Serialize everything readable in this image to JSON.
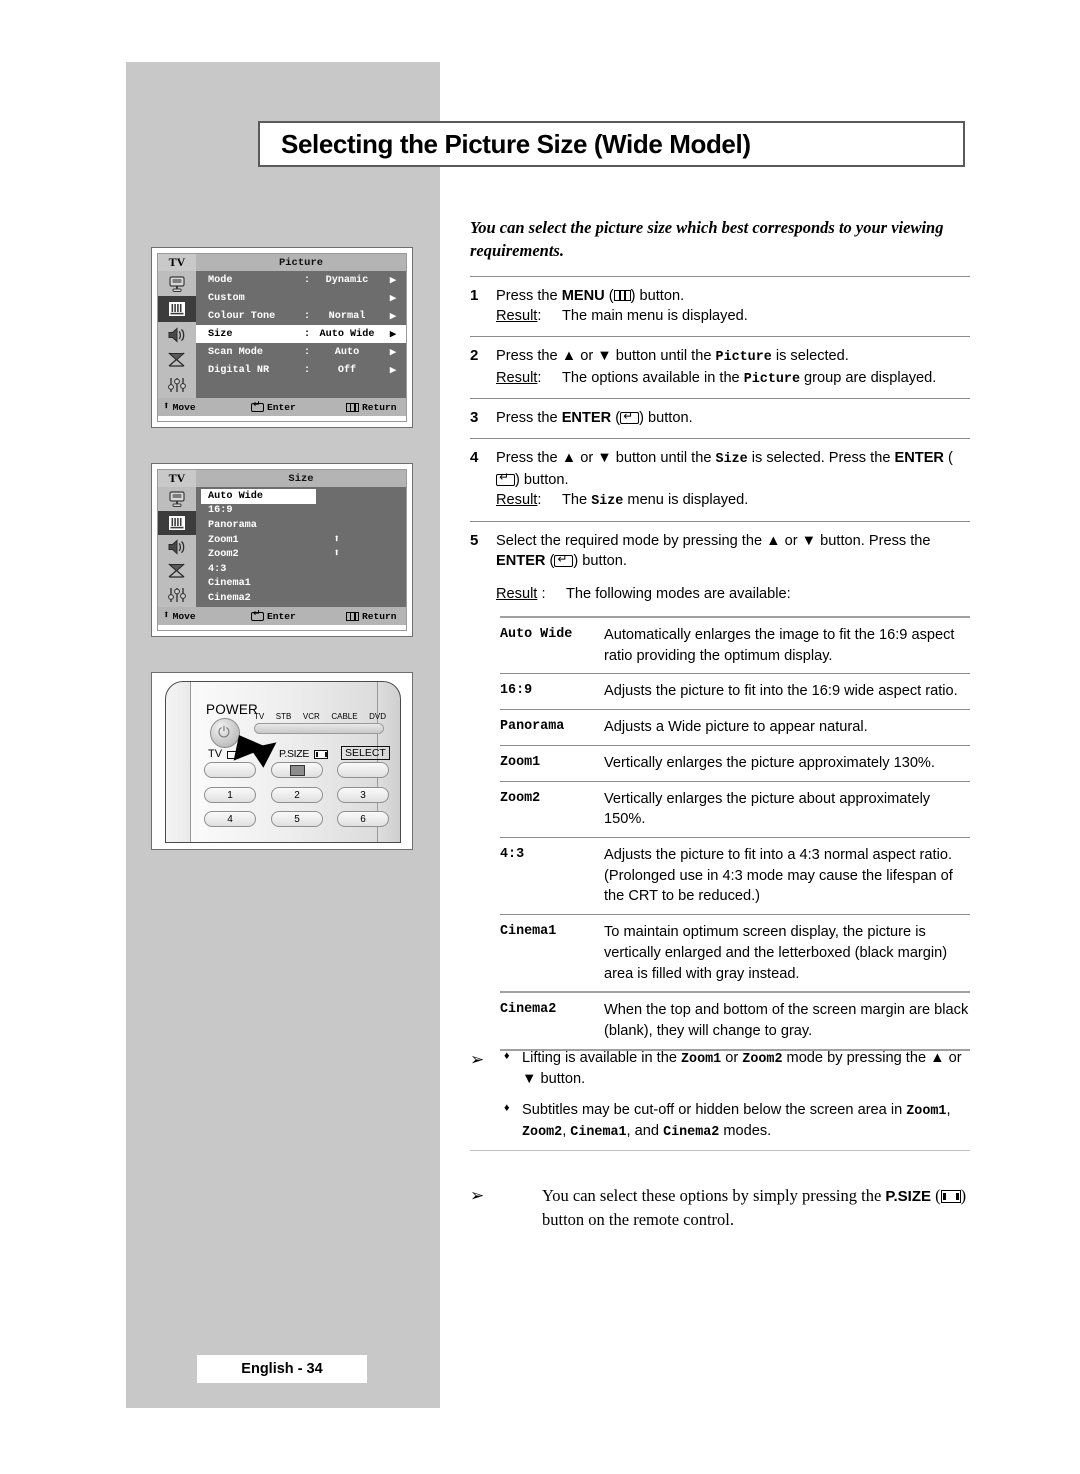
{
  "page": {
    "title": "Selecting the Picture Size (Wide Model)",
    "intro": "You can select the picture size which best corresponds to your viewing requirements.",
    "footer": "English - 34"
  },
  "osd_picture": {
    "tv_label": "TV",
    "title": "Picture",
    "rows": [
      {
        "label": "Mode",
        "colon": ":",
        "value": "Dynamic",
        "arrow": "▶",
        "highlight": false
      },
      {
        "label": "Custom",
        "colon": "",
        "value": "",
        "arrow": "▶",
        "highlight": false
      },
      {
        "label": "Colour Tone",
        "colon": ":",
        "value": "Normal",
        "arrow": "▶",
        "highlight": false
      },
      {
        "label": "Size",
        "colon": ":",
        "value": "Auto Wide",
        "arrow": "▶",
        "highlight": true
      },
      {
        "label": "Scan Mode",
        "colon": ":",
        "value": "Auto",
        "arrow": "▶",
        "highlight": false
      },
      {
        "label": "Digital NR",
        "colon": ":",
        "value": "Off",
        "arrow": "▶",
        "highlight": false
      }
    ],
    "footer": {
      "move": "Move",
      "enter": "Enter",
      "return": "Return"
    },
    "icons": [
      "tv-monitor-icon",
      "picture-bars-icon",
      "speaker-icon",
      "satellite-dish-icon",
      "sliders-icon"
    ]
  },
  "osd_size": {
    "tv_label": "TV",
    "title": "Size",
    "items": [
      {
        "label": "Auto Wide",
        "highlight": true,
        "updown": false
      },
      {
        "label": "16:9",
        "highlight": false,
        "updown": false
      },
      {
        "label": "Panorama",
        "highlight": false,
        "updown": false
      },
      {
        "label": "Zoom1",
        "highlight": false,
        "updown": true
      },
      {
        "label": "Zoom2",
        "highlight": false,
        "updown": true
      },
      {
        "label": "4:3",
        "highlight": false,
        "updown": false
      },
      {
        "label": "Cinema1",
        "highlight": false,
        "updown": false
      },
      {
        "label": "Cinema2",
        "highlight": false,
        "updown": false
      }
    ],
    "footer": {
      "move": "Move",
      "enter": "Enter",
      "return": "Return"
    },
    "icons": [
      "tv-monitor-icon",
      "picture-bars-icon",
      "speaker-icon",
      "satellite-dish-icon",
      "sliders-icon"
    ]
  },
  "remote": {
    "power_label": "POWER",
    "device_labels": [
      "TV",
      "STB",
      "VCR",
      "CABLE",
      "DVD"
    ],
    "tv_label": "TV",
    "psize_label": "P.SIZE",
    "select_label": "SELECT",
    "number_keys": [
      "1",
      "2",
      "3",
      "4",
      "5",
      "6"
    ]
  },
  "steps": [
    {
      "num": "1",
      "line1_pre": "Press the ",
      "line1_bold": "MENU",
      "line1_mid": " (",
      "line1_glyph": "menu-key-icon",
      "line1_post": ") button.",
      "result_label": "Result",
      "result_colon": ":",
      "result_text": "The main menu is displayed."
    },
    {
      "num": "2",
      "line1_pre": "Press the ▲ or ▼ button until the ",
      "line1_mono": "Picture",
      "line1_post": " is selected.",
      "result_label": "Result",
      "result_colon": ":",
      "result_pre": "The options available in the ",
      "result_mono": "Picture",
      "result_post": " group are displayed."
    },
    {
      "num": "3",
      "line1_pre": "Press the ",
      "line1_bold": "ENTER",
      "line1_mid": " (",
      "line1_glyph": "enter-key-icon",
      "line1_post": ") button."
    },
    {
      "num": "4",
      "line1_pre": "Press the ▲ or ▼ button until the ",
      "line1_mono": "Size",
      "line1_post": " is selected. Press the ",
      "line2_bold": "ENTER",
      "line2_mid": " (",
      "line2_glyph": "enter-key-icon",
      "line2_post": ") button.",
      "result_label": "Result",
      "result_colon": ":",
      "result_pre": "The ",
      "result_mono": "Size",
      "result_post": " menu is displayed."
    },
    {
      "num": "5",
      "line1_pre": "Select the required  mode by pressing the ▲ or ▼ button. Press the ",
      "line1_bold": "ENTER",
      "line1_mid": " (",
      "line1_glyph": "enter-key-icon",
      "line1_post": ") button.",
      "result_label": "Result",
      "result_colon": ":",
      "result_text": "The following modes are available:"
    }
  ],
  "modes": [
    {
      "name": "Auto Wide",
      "desc": "Automatically enlarges the image to fit the 16:9 aspect ratio providing the optimum display."
    },
    {
      "name": "16:9",
      "desc": "Adjusts the picture to fit into the 16:9 wide aspect ratio."
    },
    {
      "name": "Panorama",
      "desc": "Adjusts a Wide picture to appear natural."
    },
    {
      "name": "Zoom1",
      "desc": "Vertically enlarges the picture approximately 130%."
    },
    {
      "name": "Zoom2",
      "desc": "Vertically enlarges the picture about approximately 150%."
    },
    {
      "name": "4:3",
      "desc": "Adjusts the picture to fit into a 4:3 normal aspect ratio. (Prolonged use in 4:3 mode may cause the lifespan of the CRT to be reduced.)"
    },
    {
      "name": "Cinema1",
      "desc": "To maintain optimum screen display, the picture is vertically enlarged and the letterboxed (black margin) area is filled with gray instead."
    },
    {
      "name": "Cinema2",
      "desc": "When the top and bottom of the screen margin are black (blank), they will change to gray."
    }
  ],
  "notes": {
    "arrow": "➢",
    "bullet": "♦",
    "item1": {
      "pre": "Lifting is available in the ",
      "mono1": "Zoom1",
      "mid": " or ",
      "mono2": "Zoom2",
      "post": " mode by pressing the ▲ or ▼ button."
    },
    "item2": {
      "pre": "Subtitles may be cut-off or hidden below the screen area in ",
      "mono1": "Zoom1",
      "sep1": ", ",
      "mono2": "Zoom2",
      "sep2": ", ",
      "mono3": "Cinema1",
      "sep3": ", and ",
      "mono4": "Cinema2",
      "post": " modes."
    }
  },
  "final_note": {
    "arrow": "➢",
    "pre": "You can select these options by simply pressing the ",
    "bold": "P.SIZE",
    "mid": " (",
    "glyph": "psize-key-icon",
    "post": ") button on the remote control."
  },
  "colors": {
    "panel_gray": "#c8c8c8",
    "osd_body": "#6d6d6d",
    "osd_header": "#b4b4b4",
    "osd_icon_col": "#bdbdbd",
    "rule": "#8d8d8d"
  }
}
